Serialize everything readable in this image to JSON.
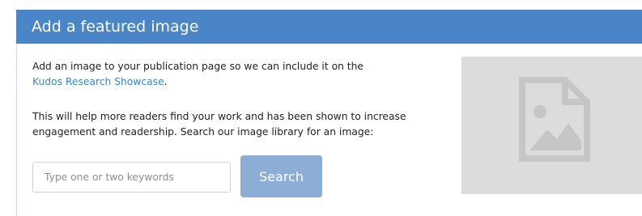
{
  "panel": {
    "title": "Add a featured image",
    "intro_text": "Add an image to your publication page so we can include it on the",
    "intro_link": "Kudos Research Showcase",
    "intro_suffix": ".",
    "description": "This will help more readers find your work and has been shown to increase engagement and readership. Search our image library for an image:"
  },
  "search": {
    "placeholder": "Type one or two keywords",
    "value": "",
    "button_label": "Search"
  },
  "preview": {
    "icon": "image-placeholder-icon"
  },
  "colors": {
    "header_bg": "#4a86c7",
    "link": "#3a86c8",
    "button_bg": "#8cadd6",
    "placeholder_bg": "#dcdcdc",
    "icon_stroke": "#c6c6c6"
  }
}
